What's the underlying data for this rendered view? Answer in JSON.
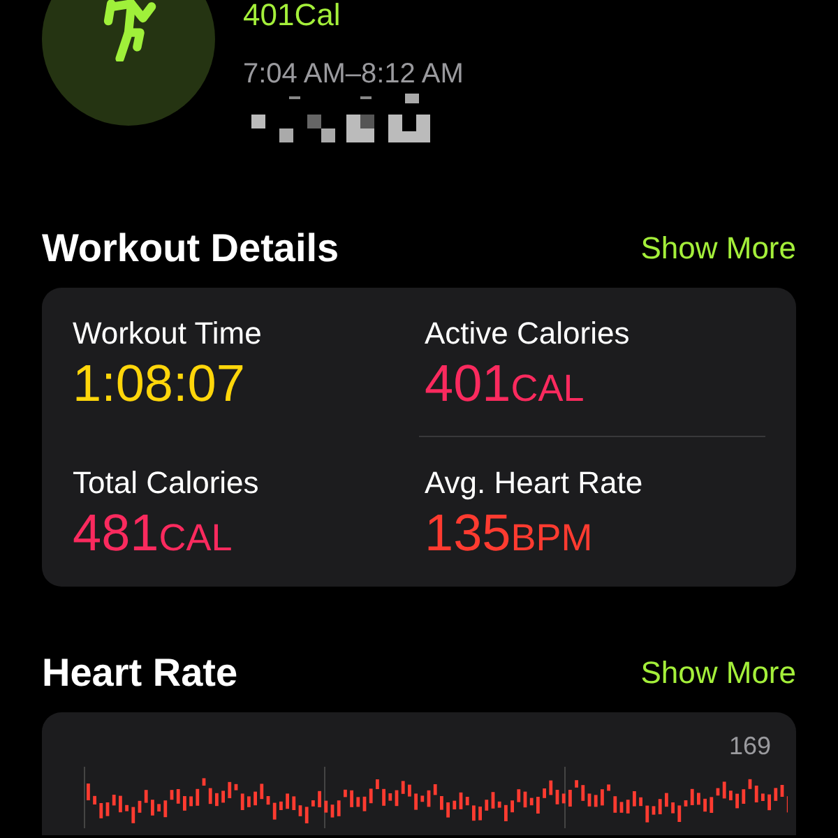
{
  "summary": {
    "calories": "401Cal",
    "time_range": "7:04 AM–8:12 AM"
  },
  "workout_details": {
    "title": "Workout Details",
    "action": "Show More",
    "metrics": [
      {
        "label": "Workout Time",
        "value": "1:08:07",
        "color": "#ffd60a"
      },
      {
        "label": "Active Calories",
        "value": "401",
        "unit": "CAL",
        "color": "#fa2a5e"
      },
      {
        "label": "Total Calories",
        "value": "481",
        "unit": "CAL",
        "color": "#fa2a5e"
      },
      {
        "label": "Avg. Heart Rate",
        "value": "135",
        "unit": "BPM",
        "color": "#ff3b30"
      }
    ]
  },
  "heart_rate": {
    "title": "Heart Rate",
    "action": "Show More",
    "axis_label": "169"
  }
}
